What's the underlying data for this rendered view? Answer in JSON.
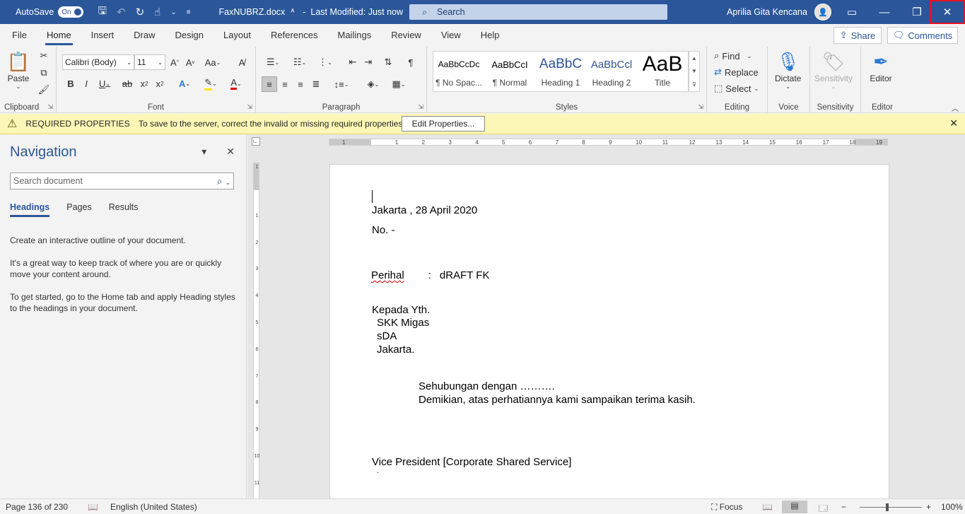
{
  "titlebar": {
    "autosave_label": "AutoSave",
    "autosave_state": "On",
    "doc_name": "FaxNUBRZ.docx",
    "modified": "Last Modified: Just now",
    "search_placeholder": "Search",
    "user_name": "Aprilia Gita Kencana",
    "accent": "#2b579a"
  },
  "tabs": [
    "File",
    "Home",
    "Insert",
    "Draw",
    "Design",
    "Layout",
    "References",
    "Mailings",
    "Review",
    "View",
    "Help"
  ],
  "active_tab": "Home",
  "share_label": "Share",
  "comments_label": "Comments",
  "ribbon": {
    "clipboard": {
      "paste": "Paste",
      "label": "Clipboard"
    },
    "font": {
      "name": "Calibri (Body)",
      "size": "11",
      "label": "Font",
      "change_case": "Aa"
    },
    "paragraph": {
      "label": "Paragraph"
    },
    "styles": {
      "label": "Styles",
      "items": [
        {
          "sample": "AaBbCcDc",
          "name": "¶ No Spac..."
        },
        {
          "sample": "AaBbCcI",
          "name": "¶ Normal"
        },
        {
          "sample": "AaBbC",
          "name": "Heading 1"
        },
        {
          "sample": "AaBbCcl",
          "name": "Heading 2"
        },
        {
          "sample": "AaB",
          "name": "Title"
        }
      ]
    },
    "editing": {
      "find": "Find",
      "replace": "Replace",
      "select": "Select",
      "label": "Editing"
    },
    "voice": {
      "dictate": "Dictate",
      "label": "Voice"
    },
    "sensitivity": {
      "button": "Sensitivity",
      "label": "Sensitivity"
    },
    "editor": {
      "button": "Editor",
      "label": "Editor"
    }
  },
  "infobar": {
    "title": "REQUIRED PROPERTIES",
    "message": "To save to the server, correct the invalid or missing required properties.",
    "button": "Edit Properties..."
  },
  "navigation": {
    "title": "Navigation",
    "search_placeholder": "Search document",
    "tabs": [
      "Headings",
      "Pages",
      "Results"
    ],
    "paragraphs": [
      "Create an interactive outline of your document.",
      "It's a great way to keep track of where you are or quickly move your content around.",
      "To get started, go to the Home tab and apply Heading styles to the headings in your document."
    ]
  },
  "document": {
    "date_line": "Jakarta , 28 April 2020",
    "no_line": "No. -",
    "perihal_label": "Perihal",
    "perihal_sep": ":",
    "perihal_value": "dRAFT FK",
    "kepada": "Kepada Yth.",
    "addr1": "SKK Migas",
    "addr2": "sDA",
    "addr3": "Jakarta.",
    "body1": "Sehubungan dengan ……….",
    "body2": "Demikian, atas perhatiannya kami sampaikan terima kasih.",
    "signature": "Vice President [Corporate Shared Service]",
    "sig_dot": "."
  },
  "ruler_numbers": [
    "1",
    "1",
    "2",
    "3",
    "4",
    "5",
    "6",
    "7",
    "8",
    "9",
    "10",
    "11",
    "12",
    "13",
    "14",
    "15",
    "16",
    "17",
    "18",
    "19"
  ],
  "vruler_numbers": [
    "1",
    "1",
    "2",
    "3",
    "4",
    "5",
    "6",
    "7",
    "8",
    "9",
    "10",
    "11"
  ],
  "statusbar": {
    "page": "Page 136 of 230",
    "language": "English (United States)",
    "focus": "Focus",
    "zoom": "100%"
  }
}
